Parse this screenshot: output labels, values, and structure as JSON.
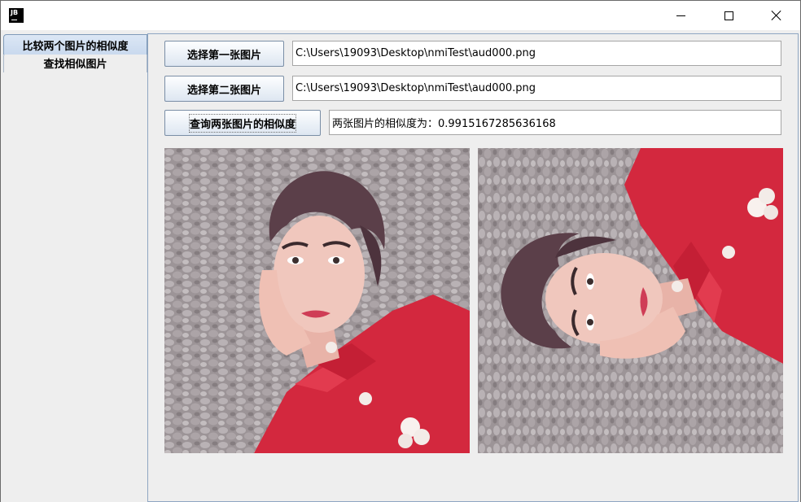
{
  "window": {
    "app_icon_text": "JB",
    "controls": [
      "minimize",
      "maximize",
      "close"
    ]
  },
  "tabs": [
    {
      "label": "比较两个图片的相似度",
      "active": true
    },
    {
      "label": "查找相似图片",
      "active": false
    }
  ],
  "compare": {
    "select_first_button": "选择第一张图片",
    "first_path": "C:\\Users\\19093\\Desktop\\nmiTest\\aud000.png",
    "select_second_button": "选择第二张图片",
    "second_path": "C:\\Users\\19093\\Desktop\\nmiTest\\aud000.png",
    "query_button": "查询两张图片的相似度",
    "result_text": "两张图片的相似度为：0.9915167285636168"
  },
  "images": [
    {
      "name": "left-portrait",
      "rotation": "upright"
    },
    {
      "name": "right-portrait",
      "rotation": "rotated-90-ccw"
    }
  ],
  "colors": {
    "tab_border": "#8fa6c2",
    "button_gradient_top": "#fdfeff",
    "button_gradient_bottom": "#dde6f1",
    "panel_background": "#eeeeee"
  }
}
